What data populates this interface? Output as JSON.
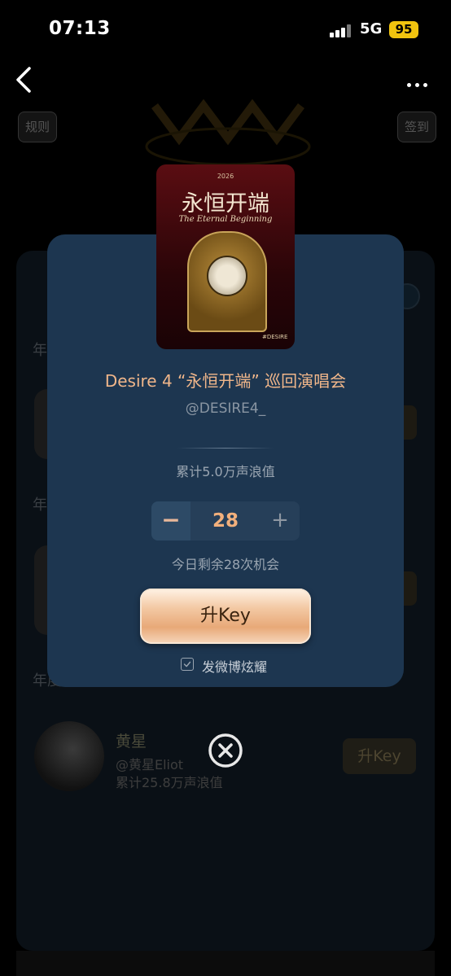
{
  "status_bar": {
    "time": "07:13",
    "network": "5G",
    "battery": "95"
  },
  "background": {
    "rules_label": "规则",
    "sign_label": "签到",
    "section_labels": [
      "年",
      "年",
      "年度"
    ],
    "artist": {
      "name": "黄星",
      "handle": "@黄星Eliot",
      "total": "累计25.8万声浪值",
      "upkey_label": "升Key"
    }
  },
  "modal": {
    "poster": {
      "year": "2026",
      "title": "永恒开端",
      "subtitle": "The Eternal Beginning",
      "tag": "#DESIRE"
    },
    "title": "Desire 4 “永恒开端” 巡回演唱会",
    "handle": "@DESIRE4_",
    "total": "累计5.0万声浪值",
    "stepper": {
      "minus": "−",
      "value": "28",
      "plus": "+"
    },
    "remaining": "今日剩余28次机会",
    "upkey_label": "升Key",
    "share_label": "发微博炫耀",
    "share_checked": true
  },
  "colors": {
    "modal_bg": "#1d3650",
    "accent": "#f0b68a",
    "button_gold": "#e8a978"
  }
}
